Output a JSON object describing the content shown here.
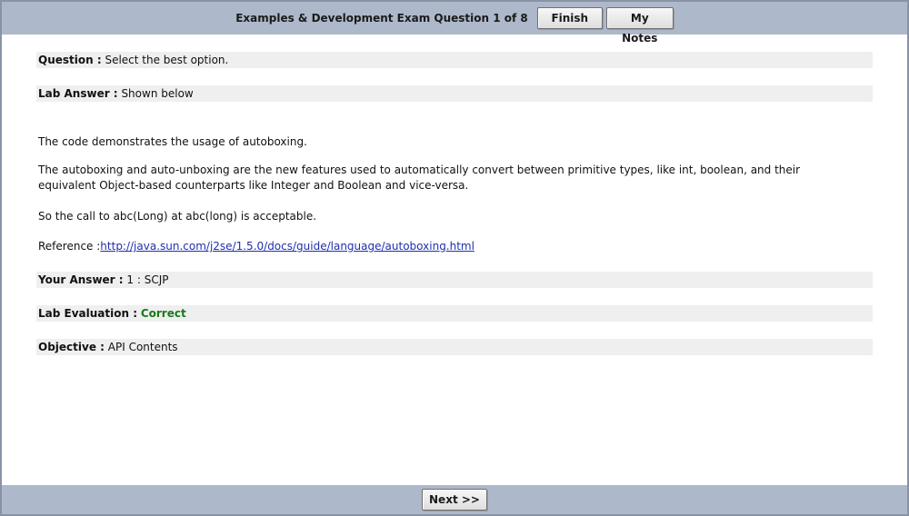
{
  "header": {
    "exam_title": "Examples & Development Exam Question 1 of 8",
    "finish_label": "Finish",
    "notes_label": "My Notes"
  },
  "question": {
    "label": "Question :",
    "text": "Select the best option."
  },
  "lab_answer": {
    "label": "Lab Answer :",
    "text": "Shown below"
  },
  "explanation": {
    "p1": "The code demonstrates the usage of autoboxing.",
    "p2": "The autoboxing and auto-unboxing are the new features used to automatically convert between primitive types, like int, boolean, and their equivalent Object-based counterparts like Integer and Boolean and vice-versa.",
    "p3": "So the call to abc(Long) at abc(long) is acceptable.",
    "reference_label": "Reference :",
    "reference_url": "http://java.sun.com/j2se/1.5.0/docs/guide/language/autoboxing.html"
  },
  "your_answer": {
    "label": "Your Answer :",
    "text": "1 : SCJP"
  },
  "evaluation": {
    "label": "Lab Evaluation :",
    "text": "Correct"
  },
  "objective": {
    "label": "Objective :",
    "text": "API Contents"
  },
  "footer": {
    "next_label": "Next >>"
  },
  "colors": {
    "bar_background": "#aeb8cb",
    "row_background": "#efefef",
    "correct": "#1a7a1a",
    "link": "#1f2fb0"
  }
}
